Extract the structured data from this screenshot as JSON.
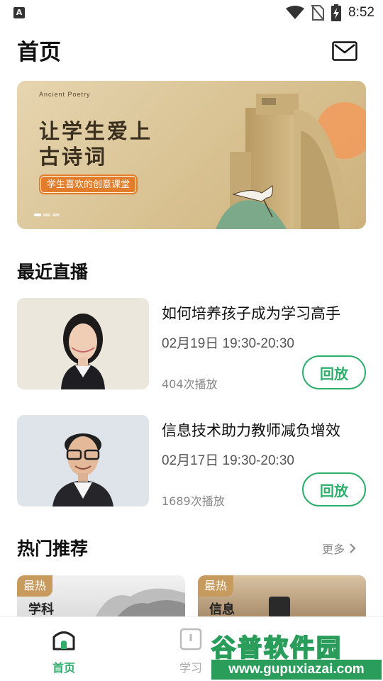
{
  "status_bar": {
    "left_icon_label": "A",
    "time": "8:52",
    "icons": [
      "wifi-icon",
      "no-sim-icon",
      "battery-charging-icon"
    ]
  },
  "header": {
    "title": "首页",
    "mail_icon": "mail-icon"
  },
  "banner": {
    "subtitle": "Ancient Poetry",
    "title_line1": "让学生爱上",
    "title_line2": "古诗词",
    "tag": "学生喜欢的创意课堂",
    "dot_count": 3,
    "active_dot": 0
  },
  "recent_live": {
    "title": "最近直播",
    "items": [
      {
        "title": "如何培养孩子成为学习高手",
        "time": "02月19日 19:30-20:30",
        "views": "404次播放",
        "button": "回放"
      },
      {
        "title": "信息技术助力教师减负增效",
        "time": "02月17日 19:30-20:30",
        "views": "1689次播放",
        "button": "回放"
      }
    ]
  },
  "hot": {
    "title": "热门推荐",
    "more": "更多",
    "cards": [
      {
        "badge": "最热",
        "caption": "学科"
      },
      {
        "badge": "最热",
        "caption": "信息"
      }
    ]
  },
  "bottom_nav": {
    "items": [
      {
        "label": "首页",
        "icon": "home-icon",
        "active": true
      },
      {
        "label": "学习",
        "icon": "study-icon",
        "active": false
      }
    ]
  },
  "watermark": {
    "big": "谷普软件园",
    "small": "www.gupuxiazai.com"
  },
  "colors": {
    "accent": "#2eae6b",
    "badge": "#c79a5d",
    "banner_tag": "#e27d2b"
  }
}
